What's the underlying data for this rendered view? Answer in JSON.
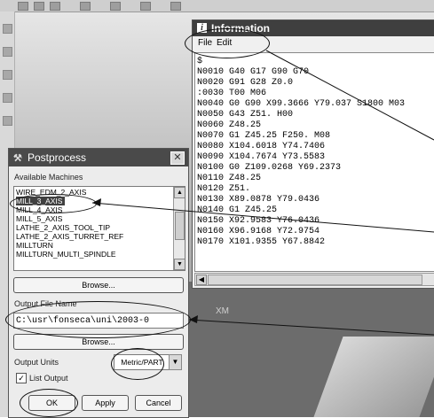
{
  "information_window": {
    "title": "Information",
    "title_icon": "info-icon",
    "menu": [
      "File",
      "Edit"
    ],
    "lines": [
      "$",
      "N0010 G40 G17 G90 G70",
      "N0020 G91 G28 Z0.0",
      ":0030 T00 M06",
      "N0040 G0 G90 X99.3666 Y79.037 S1800 M03",
      "N0050 G43 Z51. H00",
      "N0060 Z48.25",
      "N0070 G1 Z45.25 F250. M08",
      "N0080 X104.6018 Y74.7406",
      "N0090 X104.7674 Y73.5583",
      "N0100 G0 Z109.0268 Y69.2373",
      "N0110 Z48.25",
      "N0120 Z51.",
      "N0130 X89.0878 Y79.0436",
      "N0140 G1 Z45.25",
      "N0150 X92.9583 Y76.0436",
      "N0160 X96.9168 Y72.9754",
      "N0170 X101.9355 Y67.8842"
    ]
  },
  "postprocess_dialog": {
    "title": "Postprocess",
    "title_icon": "postprocess-icon",
    "close_glyph": "✕",
    "available_machines_label": "Available Machines",
    "machines": [
      "WIRE_EDM_2_AXIS",
      "MILL_3_AXIS",
      "MILL_4_AXIS",
      "MILL_5_AXIS",
      "LATHE_2_AXIS_TOOL_TIP",
      "LATHE_2_AXIS_TURRET_REF",
      "MILLTURN",
      "MILLTURN_MULTI_SPINDLE"
    ],
    "selected_machine": "MILL_3_AXIS",
    "browse_label": "Browse...",
    "output_file_name_label": "Output File Name",
    "output_file_value": "C:\\usr\\fonseca\\uni\\2003-0",
    "output_units_label": "Output Units",
    "output_units_value": "Metric/PART",
    "list_output_label": "List Output",
    "list_output_checked": true,
    "ok_label": "OK",
    "apply_label": "Apply",
    "cancel_label": "Cancel"
  },
  "canvas": {
    "xm_label": "XM"
  }
}
